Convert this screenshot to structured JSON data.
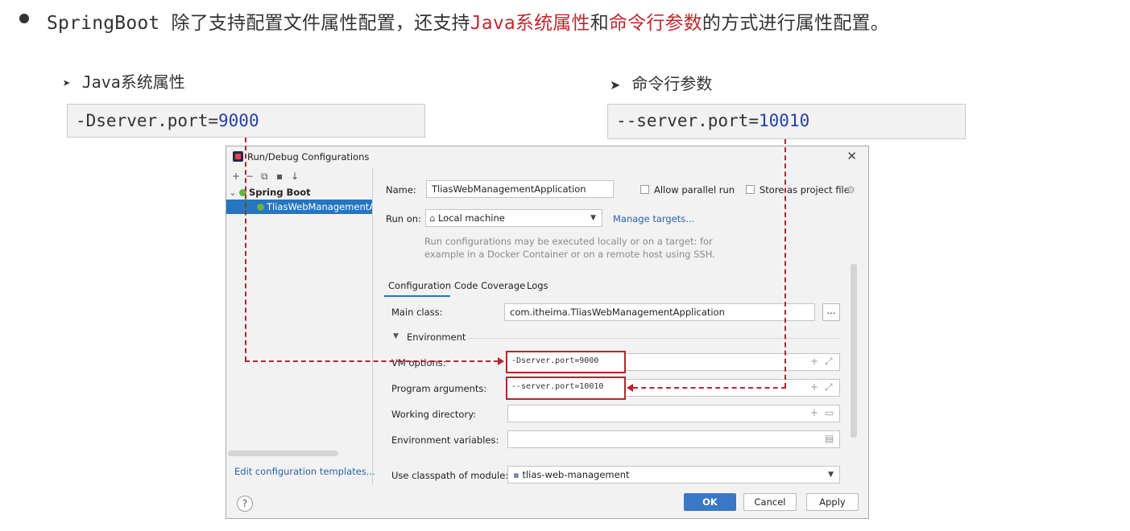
{
  "slide": {
    "bullet_prefix": "SpringBoot 除了支持配置文件属性配置，还支持",
    "bullet_hl1": "Java系统属性",
    "bullet_mid": "和",
    "bullet_hl2": "命令行参数",
    "bullet_suffix": "的方式进行属性配置。",
    "left_sub": "Java系统属性",
    "right_sub": "命令行参数",
    "left_code_prefix": "-Dserver.port=",
    "left_code_num": "9000",
    "right_code_prefix": "--server.port=",
    "right_code_num": "10010",
    "accent_color": "#c0282e"
  },
  "dialog": {
    "title": "Run/Debug Configurations",
    "toolbar": [
      "+",
      "−",
      "⧉",
      "▪",
      "↓"
    ],
    "tree": {
      "group_label": "Spring Boot",
      "selected_item": "TliasWebManagementApplication"
    },
    "edit_templates_link": "Edit configuration templates...",
    "name_label": "Name:",
    "name_value": "TliasWebManagementApplication",
    "allow_parallel_label": "Allow parallel run",
    "store_project_label": "Store as project file",
    "run_on_label": "Run on:",
    "run_on_value": "Local machine",
    "manage_targets_link": "Manage targets...",
    "hint_line1": "Run configurations may be executed locally or on a target: for",
    "hint_line2": "example in a Docker Container or on a remote host using SSH.",
    "tabs": [
      "Configuration",
      "Code Coverage",
      "Logs"
    ],
    "main_class_label": "Main class:",
    "main_class_value": "com.itheima.TliasWebManagementApplication",
    "browse_btn": "...",
    "environment_label": "Environment",
    "vm_options_label": "VM options:",
    "vm_options_value": "-Dserver.port=9000",
    "program_args_label": "Program arguments:",
    "program_args_value": "--server.port=10010",
    "working_dir_label": "Working directory:",
    "env_vars_label": "Environment variables:",
    "classpath_label": "Use classpath of module:",
    "classpath_value": "tlias-web-management",
    "help_label": "?",
    "ok_label": "OK",
    "cancel_label": "Cancel",
    "apply_label": "Apply"
  }
}
